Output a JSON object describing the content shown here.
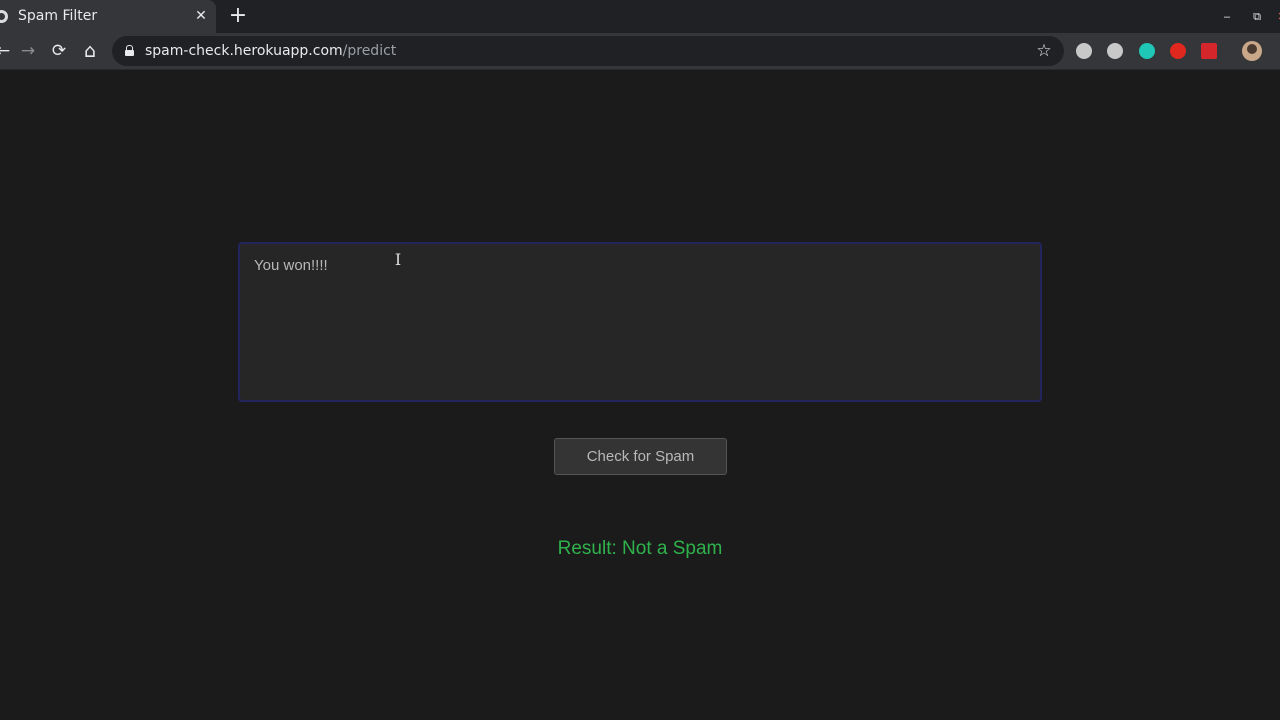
{
  "browser": {
    "tab": {
      "title": "Spam Filter",
      "close_glyph": "✕"
    },
    "new_tab_glyph": "+",
    "window_controls": {
      "minimize": "–",
      "restore": "⧉",
      "close": "✕"
    },
    "nav": {
      "back": "←",
      "forward": "→",
      "reload": "⟳",
      "home": "⌂"
    },
    "address": {
      "host": "spam-check.herokuapp.com",
      "path": "/predict"
    },
    "bookmark_glyph": "☆",
    "extensions": [
      {
        "name": "cube-extension-icon",
        "color": "#c8c8c8"
      },
      {
        "name": "play-extension-icon",
        "color": "#c8c8c8"
      },
      {
        "name": "m-extension-icon",
        "color": "#1fc7b6"
      },
      {
        "name": "flame-extension-icon",
        "color": "#e0281e"
      },
      {
        "name": "book-extension-icon",
        "color": "#d5262b"
      }
    ]
  },
  "page": {
    "message": {
      "value": "You won!!!!"
    },
    "cursor_glyph": "I",
    "check_button_label": "Check for Spam",
    "result_text": "Result: Not a Spam",
    "result_color": "#2fb24c"
  }
}
